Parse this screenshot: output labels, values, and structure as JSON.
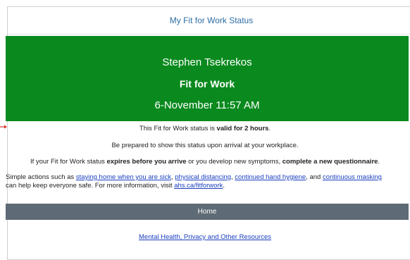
{
  "header": {
    "title": "My Fit for Work Status"
  },
  "status": {
    "name": "Stephen Tsekrekos",
    "label": "Fit for Work",
    "datetime": "6-November 11:57 AM",
    "color": "#0a8a1e"
  },
  "info": {
    "line1_pre": "This Fit for Work status is ",
    "line1_bold": "valid for 2 hours",
    "line1_post": ".",
    "line2": "Be prepared to show this status upon arrival at your workplace.",
    "line3_pre": "If your Fit for Work status ",
    "line3_bold1": "expires before you arrive",
    "line3_mid": " or you develop new symptoms, ",
    "line3_bold2": "complete a new questionnaire",
    "line3_post": "."
  },
  "actions": {
    "pre": "Simple actions such as ",
    "link1": "staying home when you are sick",
    "sep1": ", ",
    "link2": "physical distancing",
    "sep2": ", ",
    "link3": "continued hand hygiene",
    "sep3": ", and ",
    "link4": "continuous masking",
    "line2_pre": "can help keep everyone safe. For more information, visit ",
    "link5": "ahs.ca/fitforwork",
    "line2_post": "."
  },
  "home_button": {
    "label": "Home",
    "color": "#5e6a75"
  },
  "footer": {
    "link": "Mental Health, Privacy and Other Resources"
  }
}
